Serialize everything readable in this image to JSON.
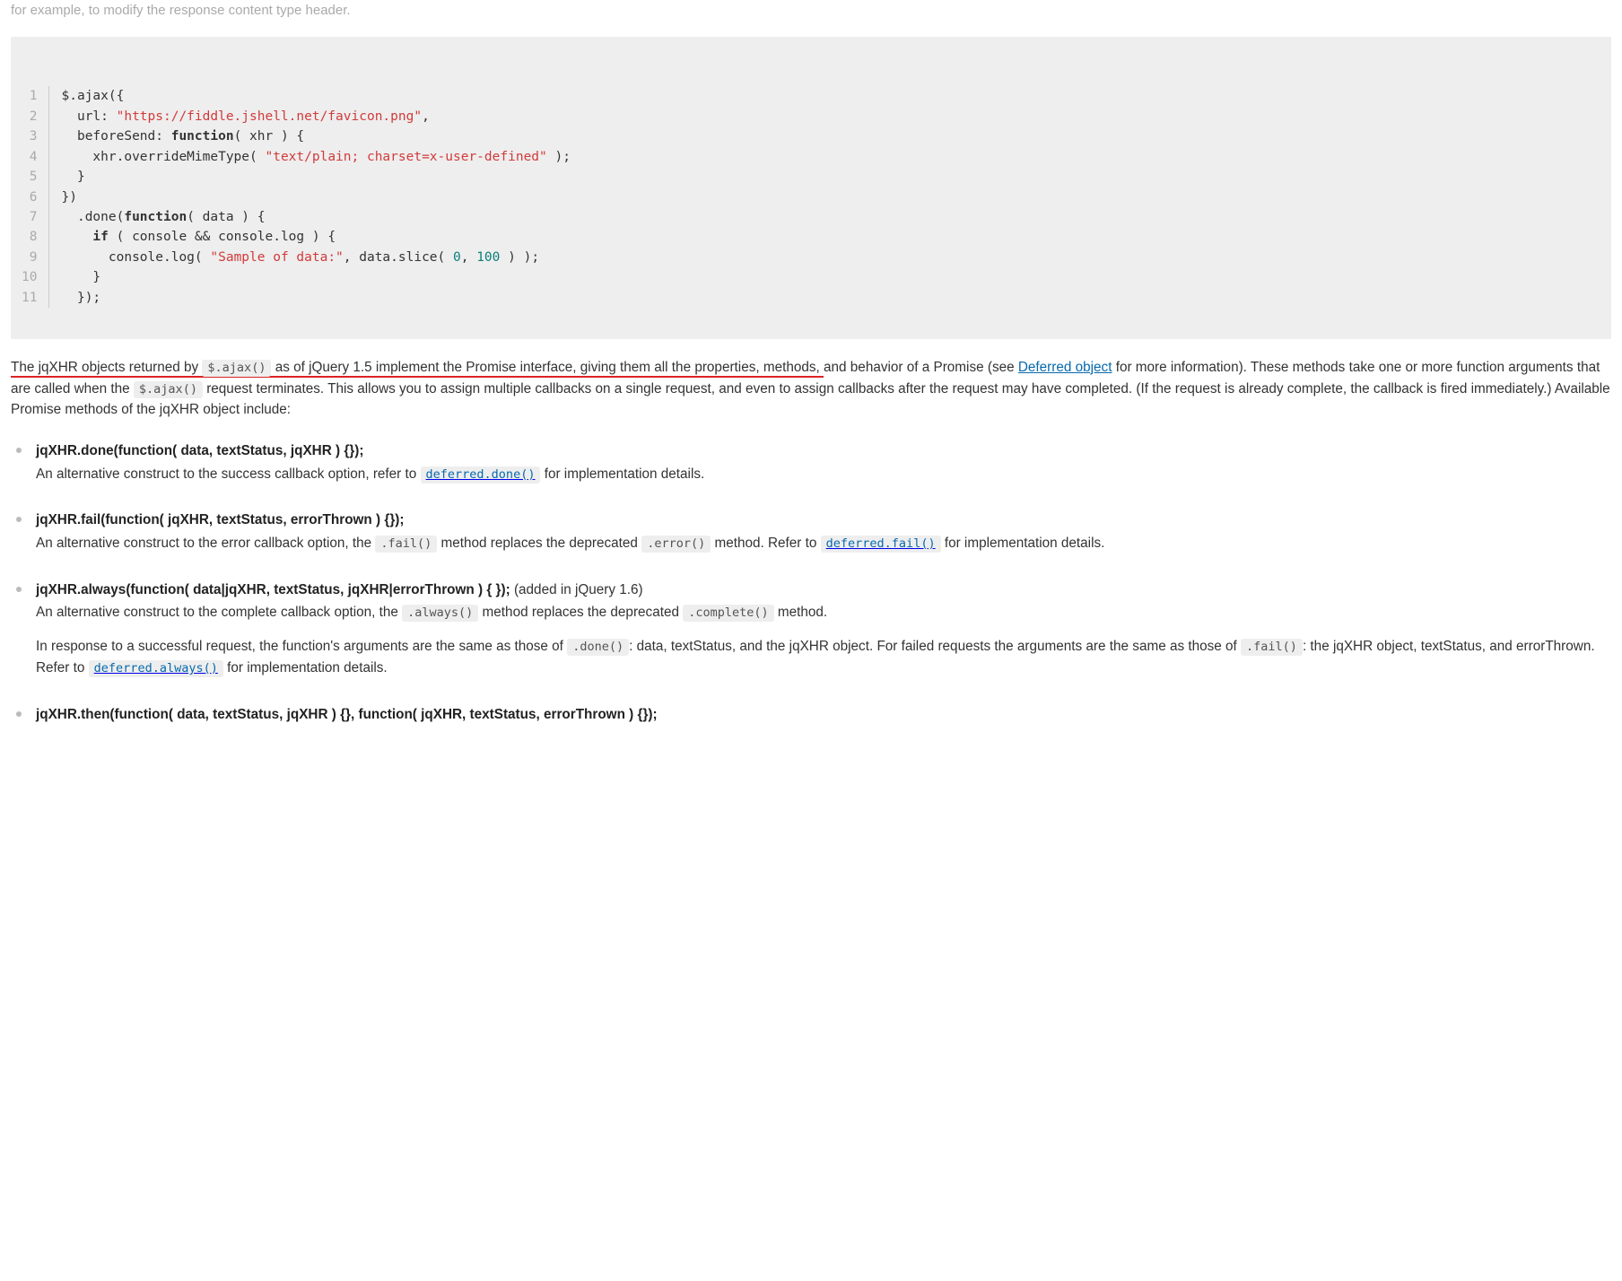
{
  "intro_cut": "for example, to modify the response content type header.",
  "code": [
    {
      "ln": "1",
      "html": "$.ajax({"
    },
    {
      "ln": "2",
      "html": "  url: <span class=\"code-str\">\"https://fiddle.jshell.net/favicon.png\"</span>,"
    },
    {
      "ln": "3",
      "html": "  beforeSend: <span class=\"code-kw\">function</span>( xhr ) {"
    },
    {
      "ln": "4",
      "html": "    xhr.overrideMimeType( <span class=\"code-str\">\"text/plain; charset=x-user-defined\"</span> );"
    },
    {
      "ln": "5",
      "html": "  }"
    },
    {
      "ln": "6",
      "html": "})"
    },
    {
      "ln": "7",
      "html": "  .done(<span class=\"code-kw\">function</span>( data ) {"
    },
    {
      "ln": "8",
      "html": "    <span class=\"code-kw\">if</span> ( console && console.log ) {"
    },
    {
      "ln": "9",
      "html": "      console.log( <span class=\"code-str\">\"Sample of data:\"</span>, data.slice( <span class=\"code-num\">0</span>, <span class=\"code-num\">100</span> ) );"
    },
    {
      "ln": "10",
      "html": "    }"
    },
    {
      "ln": "11",
      "html": "  });"
    }
  ],
  "para_underlined": "The jqXHR objects returned by ",
  "inline_ajax": "$.ajax()",
  "para_underlined_2": " as of jQuery 1.5 implement the Promise interface, giving them all the properties, methods,",
  "para_rest_1": " and behavior of a Promise (see ",
  "deferred_link": "Deferred object",
  "para_rest_2": " for more information). These methods take one or more function arguments that are called when the ",
  "para_rest_3": " request terminates. This allows you to assign multiple callbacks on a single request, and even to assign callbacks after the request may have completed. (If the request is already complete, the callback is fired immediately.) Available Promise methods of the jqXHR object include:",
  "methods": {
    "done": {
      "sig": "jqXHR.done(function( data, textStatus, jqXHR ) {});",
      "p1a": "An alternative construct to the success callback option, refer to ",
      "code1": "deferred.done()",
      "p1b": " for implementation details."
    },
    "fail": {
      "sig": "jqXHR.fail(function( jqXHR, textStatus, errorThrown ) {});",
      "p1a": "An alternative construct to the error callback option, the ",
      "code1": ".fail()",
      "p1b": " method replaces the deprecated ",
      "code2": ".error()",
      "p1c": " method. Refer to ",
      "code3": "deferred.fail()",
      "p1d": " for implementation details."
    },
    "always": {
      "sig": "jqXHR.always(function( data|jqXHR, textStatus, jqXHR|errorThrown ) { });",
      "added": " (added in jQuery 1.6)",
      "p1a": "An alternative construct to the complete callback option, the ",
      "code1": ".always()",
      "p1b": " method replaces the deprecated ",
      "code2": ".complete()",
      "p1c": " method.",
      "p2a": "In response to a successful request, the function's arguments are the same as those of ",
      "code3": ".done()",
      "p2b": ": data, textStatus, and the jqXHR object. For failed requests the arguments are the same as those of ",
      "code4": ".fail()",
      "p2c": ": the jqXHR object, textStatus, and errorThrown. Refer to ",
      "code5": "deferred.always()",
      "p2d": " for implementation details."
    },
    "then": {
      "sig": "jqXHR.then(function( data, textStatus, jqXHR ) {}, function( jqXHR, textStatus, errorThrown ) {});"
    }
  }
}
